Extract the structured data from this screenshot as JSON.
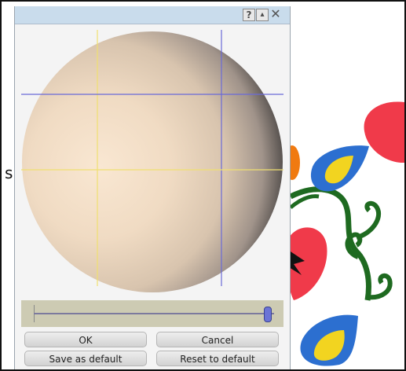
{
  "dialog": {
    "titlebar": {
      "help": "?",
      "collapse": "▴",
      "close": "✕"
    },
    "buttons": {
      "ok": "OK",
      "cancel": "Cancel",
      "save_default": "Save as default",
      "reset_default": "Reset to default"
    },
    "slider": {
      "level": 0.97
    }
  },
  "background": {
    "clipped_letter": "s"
  },
  "colors": {
    "titlebar": "#c9dcec",
    "sphere_light": "#f5e0c8",
    "sphere_dark": "#2a2a2a",
    "guide_horizontal_blue": "#6a6ad8",
    "guide_yellow": "#f0e070",
    "slider_panel": "#cdcbb3",
    "slider_thumb": "#6b74d6",
    "embroidery_red": "#f03a4a",
    "embroidery_blue": "#2c6fd0",
    "embroidery_yellow": "#f2d420",
    "embroidery_green": "#1e6a20",
    "embroidery_orange": "#f07a10"
  }
}
